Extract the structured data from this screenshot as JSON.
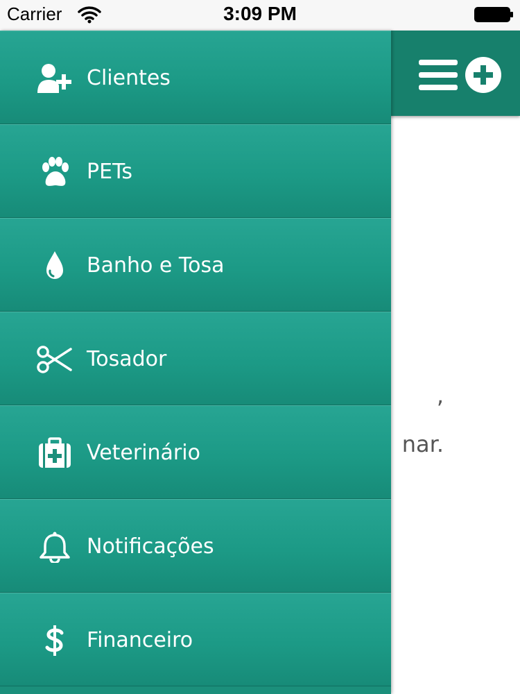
{
  "status_bar": {
    "carrier": "Carrier",
    "time": "3:09 PM",
    "wifi_icon": "wifi-icon",
    "battery_icon": "battery-icon"
  },
  "header": {
    "background_color": "#17806c",
    "menu_icon": "hamburger-icon",
    "add_icon": "plus-circle-icon"
  },
  "background_content": {
    "line1": ",",
    "line2": "nar."
  },
  "drawer": {
    "background_color": "#1b8f7b",
    "items": [
      {
        "label": "Clientes",
        "icon": "add-user-icon"
      },
      {
        "label": "PETs",
        "icon": "paw-icon"
      },
      {
        "label": "Banho e Tosa",
        "icon": "drop-icon"
      },
      {
        "label": "Tosador",
        "icon": "scissors-icon"
      },
      {
        "label": "Veterinário",
        "icon": "medical-kit-icon"
      },
      {
        "label": "Notificações",
        "icon": "bell-icon"
      },
      {
        "label": "Financeiro",
        "icon": "dollar-icon"
      }
    ]
  }
}
